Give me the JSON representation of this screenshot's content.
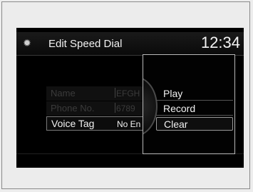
{
  "header": {
    "icon": "gear-icon",
    "title": "Edit Speed Dial",
    "clock": "12:34"
  },
  "list": {
    "rows": [
      {
        "label": "Name",
        "value": "EFGH"
      },
      {
        "label": "Phone No.",
        "value": "6789"
      },
      {
        "label": "Voice Tag",
        "value": "No En"
      }
    ]
  },
  "popup_menu": {
    "items": [
      {
        "label": "Play"
      },
      {
        "label": "Record"
      },
      {
        "label": "Clear"
      }
    ],
    "selected": "Clear"
  },
  "colors": {
    "screen_background": "#000000",
    "text": "#f2f2f2",
    "dim_text": "#3b3b3b"
  }
}
